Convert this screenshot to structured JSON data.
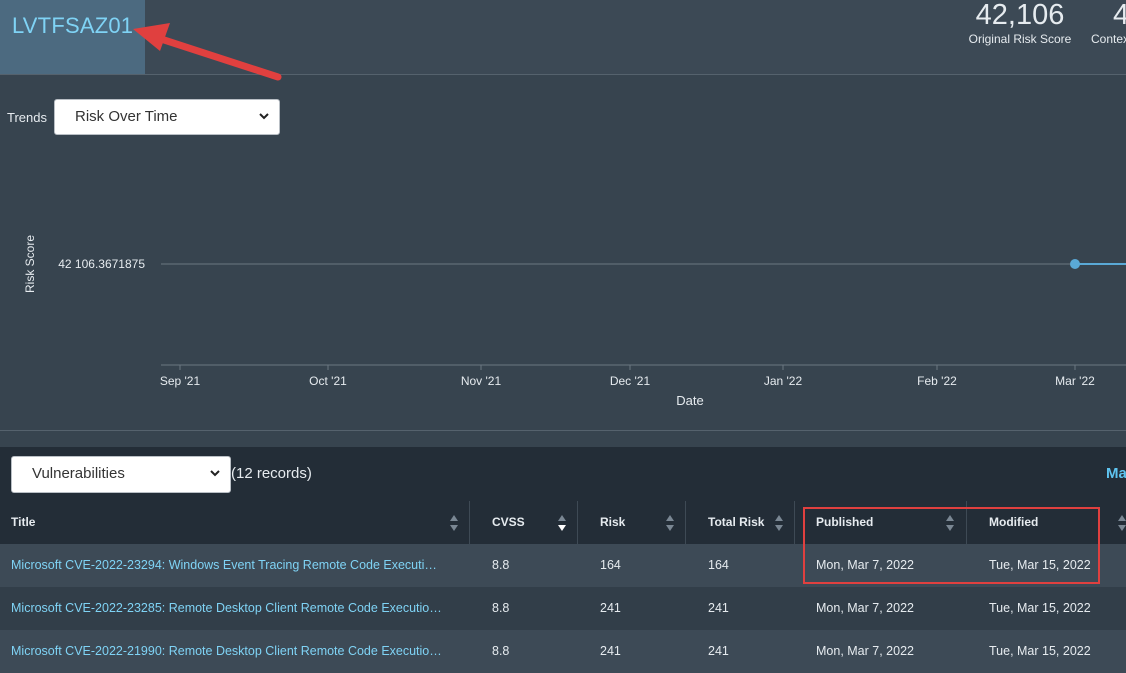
{
  "asset": {
    "name": "LVTFSAZ01"
  },
  "metrics": [
    {
      "value": "42,106",
      "label": "Original Risk Score"
    },
    {
      "value": "4",
      "label": "Contex"
    }
  ],
  "trends": {
    "label": "Trends",
    "selected": "Risk Over Time"
  },
  "chart_data": {
    "type": "line",
    "xlabel": "Date",
    "ylabel": "Risk Score",
    "x_ticks": [
      "Sep '21",
      "Oct '21",
      "Nov '21",
      "Dec '21",
      "Jan '22",
      "Feb '22",
      "Mar '22"
    ],
    "y_ticks": [
      "42 106.3671875"
    ],
    "series": [
      {
        "points": [
          {
            "x": "2022-03-01",
            "y": 42106.3671875
          },
          {
            "x": "2022-03-15",
            "y": 42106.3671875
          }
        ]
      }
    ]
  },
  "vulnerabilities": {
    "selected": "Vulnerabilities",
    "records": "(12 records)",
    "link": "Ma"
  },
  "table": {
    "headers": [
      "Title",
      "CVSS",
      "Risk",
      "Total Risk",
      "Published",
      "Modified"
    ],
    "rows": [
      [
        "Microsoft CVE-2022-23294: Windows Event Tracing Remote Code Executi…",
        "8.8",
        "164",
        "164",
        "Mon, Mar 7, 2022",
        "Tue, Mar 15, 2022"
      ],
      [
        "Microsoft CVE-2022-23285: Remote Desktop Client Remote Code Executio…",
        "8.8",
        "241",
        "241",
        "Mon, Mar 7, 2022",
        "Tue, Mar 15, 2022"
      ],
      [
        "Microsoft CVE-2022-21990: Remote Desktop Client Remote Code Executio…",
        "8.8",
        "241",
        "241",
        "Mon, Mar 7, 2022",
        "Tue, Mar 15, 2022"
      ]
    ]
  },
  "colors": {
    "accent": "#7fd3f5",
    "annotation": "#e0403f",
    "line": "#5aa9d6"
  }
}
